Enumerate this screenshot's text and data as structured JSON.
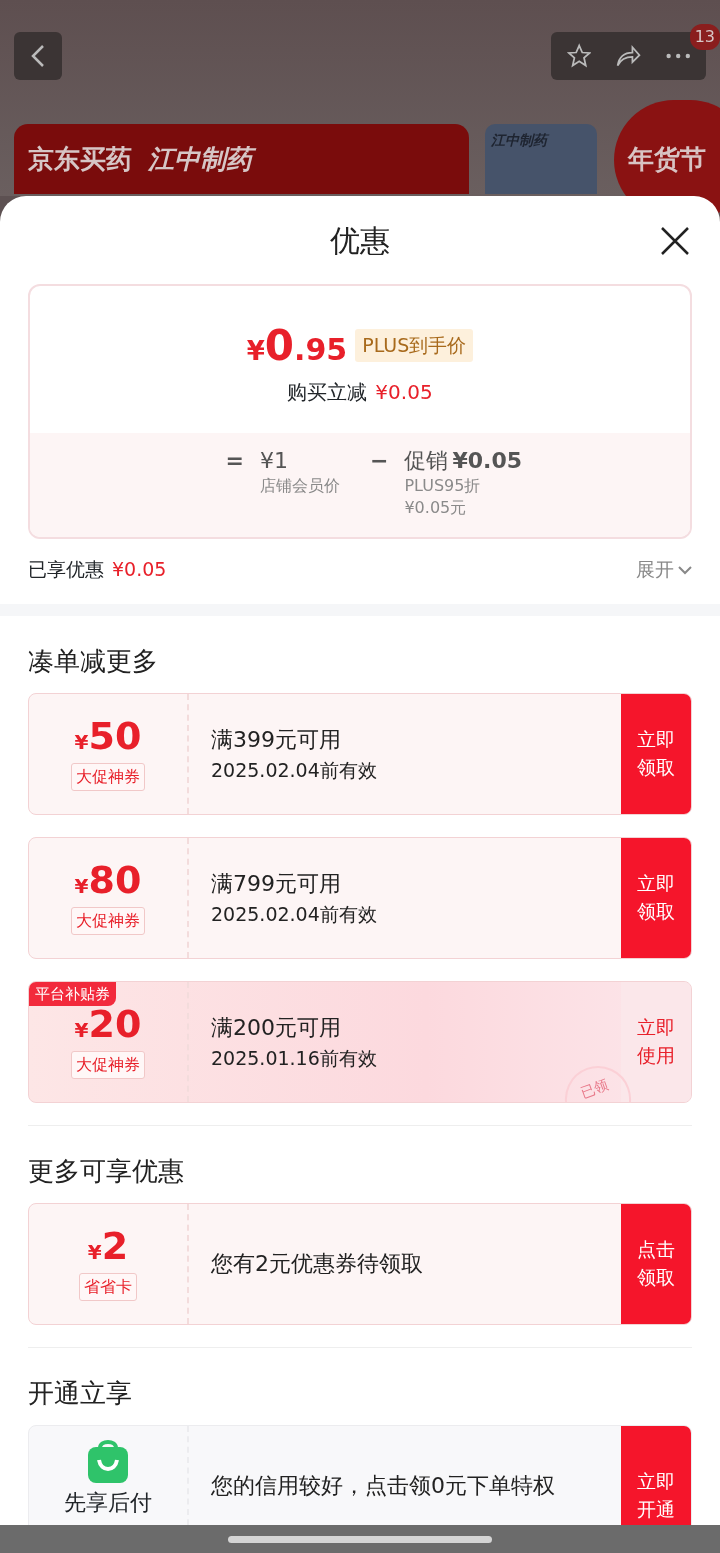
{
  "top_bar": {
    "badge": "13"
  },
  "banner": {
    "logos": [
      "京东买药",
      "江中制药"
    ],
    "side_logo": "江中制药",
    "festival": "年货节"
  },
  "sheet": {
    "title": "优惠",
    "price": {
      "currency": "¥",
      "integer": "0",
      "decimal": ".95",
      "tag": "PLUS到手价",
      "instant_label": "购买立减",
      "instant_value": "¥0.05"
    },
    "breakdown": {
      "equals": "=",
      "base_value": "¥1",
      "base_label": "店铺会员价",
      "minus": "−",
      "promo_label": "促销",
      "promo_value": "¥0.05",
      "promo_notes": [
        "PLUS95折",
        "¥0.05元"
      ]
    },
    "summary": {
      "label": "已享优惠",
      "value": "¥0.05",
      "expand": "展开"
    },
    "sections": [
      {
        "title": "凑单减更多",
        "coupons": [
          {
            "kind": "amount",
            "currency": "¥",
            "amount": "50",
            "tag": "大促神券",
            "condition": "满399元可用",
            "validity": "2025.02.04前有效",
            "action": "立即领取",
            "claimed": false
          },
          {
            "kind": "amount",
            "currency": "¥",
            "amount": "80",
            "tag": "大促神券",
            "condition": "满799元可用",
            "validity": "2025.02.04前有效",
            "action": "立即领取",
            "claimed": false
          },
          {
            "kind": "amount",
            "corner": "平台补贴券",
            "currency": "¥",
            "amount": "20",
            "tag": "大促神券",
            "condition": "满200元可用",
            "validity": "2025.01.16前有效",
            "action": "立即使用",
            "claimed": true,
            "stamp": "已领"
          }
        ]
      },
      {
        "title": "更多可享优惠",
        "coupons": [
          {
            "kind": "amount",
            "currency": "¥",
            "amount": "2",
            "tag": "省省卡",
            "condition": "您有2元优惠券待领取",
            "action": "点击领取",
            "claimed": false
          }
        ]
      },
      {
        "title": "开通立享",
        "coupons": [
          {
            "kind": "service",
            "name": "先享后付",
            "condition": "您的信用较好，点击领0元下单特权",
            "action": "立即开通",
            "claimed": false
          }
        ]
      }
    ]
  }
}
